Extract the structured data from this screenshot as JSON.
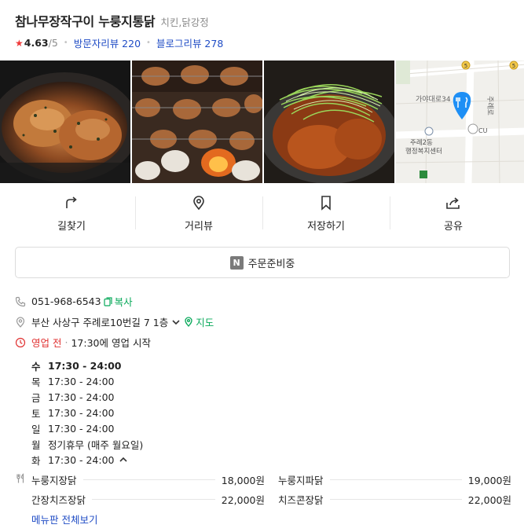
{
  "place": {
    "name": "참나무장작구이 누룽지통닭",
    "category": "치킨,닭강정",
    "rating": "4.63",
    "rating_max": "/5",
    "visitor_review": "방문자리뷰 220",
    "blog_review": "블로그리뷰 278"
  },
  "map_tile": {
    "labels": [
      "가야대로34",
      "주례로",
      "CU",
      "주례2동",
      "행정복지센터",
      "5",
      "5"
    ]
  },
  "actions": [
    {
      "label": "길찾기",
      "icon": "directions-icon"
    },
    {
      "label": "거리뷰",
      "icon": "street-view-icon"
    },
    {
      "label": "저장하기",
      "icon": "bookmark-icon"
    },
    {
      "label": "공유",
      "icon": "share-icon"
    }
  ],
  "order_button": {
    "badge": "N",
    "label": "주문준비중"
  },
  "contact": {
    "phone": "051-968-6543",
    "copy_label": "복사"
  },
  "address": {
    "text": "부산 사상구 주례로10번길 7 1층",
    "map_label": "지도"
  },
  "status": {
    "state": "영업 전",
    "separator": "·",
    "next": "17:30에 영업 시작"
  },
  "hours": [
    {
      "day": "수",
      "time": "17:30 - 24:00"
    },
    {
      "day": "목",
      "time": "17:30 - 24:00"
    },
    {
      "day": "금",
      "time": "17:30 - 24:00"
    },
    {
      "day": "토",
      "time": "17:30 - 24:00"
    },
    {
      "day": "일",
      "time": "17:30 - 24:00"
    },
    {
      "day": "월",
      "time": "정기휴무 (매주 월요일)"
    },
    {
      "day": "화",
      "time": "17:30 - 24:00"
    }
  ],
  "menu": [
    {
      "name": "누룽지장닭",
      "price": "18,000원"
    },
    {
      "name": "누룽지파닭",
      "price": "19,000원"
    },
    {
      "name": "간장치즈장닭",
      "price": "22,000원"
    },
    {
      "name": "치즈콘장닭",
      "price": "22,000원"
    }
  ],
  "menu_more": "메뉴판 전체보기",
  "colors": {
    "link_blue": "#1f4cc5",
    "green": "#08a95a",
    "red": "#e03131",
    "star": "#ef3a3a",
    "pin_blue": "#1e8ff5"
  }
}
